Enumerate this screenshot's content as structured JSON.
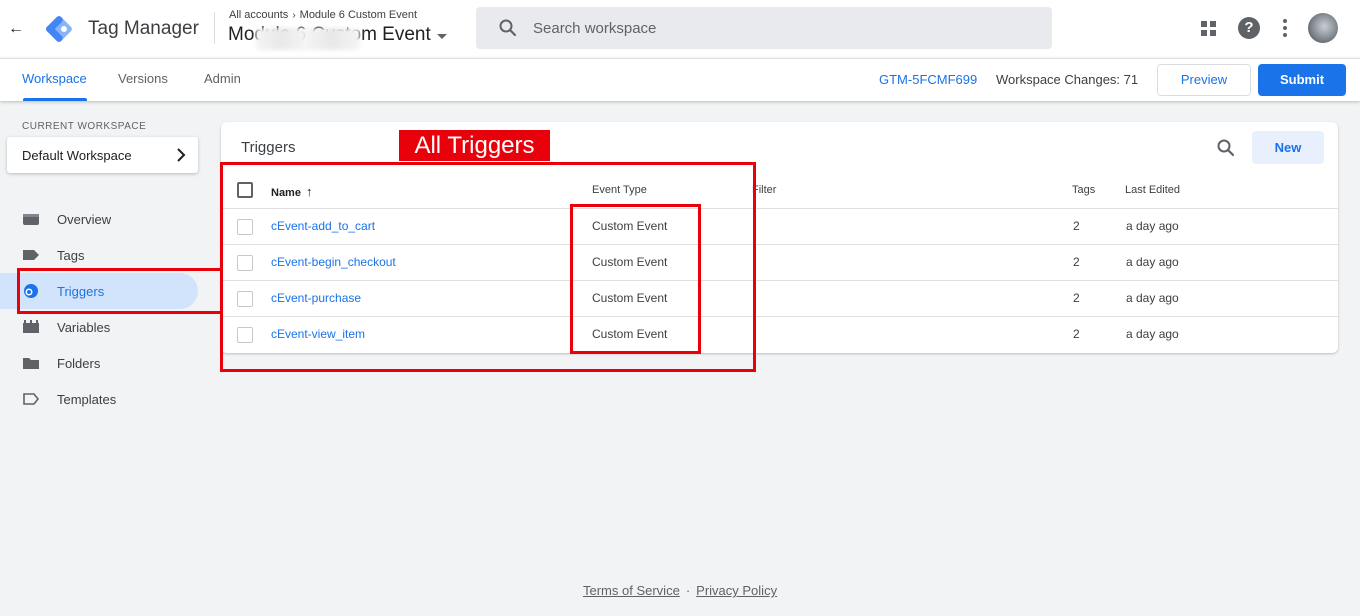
{
  "header": {
    "app_title": "Tag Manager",
    "breadcrumb": {
      "account": "All accounts",
      "container": "Module 6 Custom Event"
    },
    "container_name": "Module 6 Custom Event",
    "search_placeholder": "Search workspace",
    "help_glyph": "?"
  },
  "nav": {
    "tabs": [
      {
        "label": "Workspace",
        "active": true
      },
      {
        "label": "Versions",
        "active": false
      },
      {
        "label": "Admin",
        "active": false
      }
    ],
    "container_id": "GTM-5FCMF699",
    "workspace_changes": "Workspace Changes: 71",
    "preview_label": "Preview",
    "submit_label": "Submit"
  },
  "sidebar": {
    "current_workspace_label": "CURRENT WORKSPACE",
    "workspace_name": "Default Workspace",
    "items": [
      {
        "label": "Overview",
        "icon": "overview-icon",
        "active": false
      },
      {
        "label": "Tags",
        "icon": "tag-icon",
        "active": false
      },
      {
        "label": "Triggers",
        "icon": "trigger-icon",
        "active": true
      },
      {
        "label": "Variables",
        "icon": "variables-icon",
        "active": false
      },
      {
        "label": "Folders",
        "icon": "folder-icon",
        "active": false
      },
      {
        "label": "Templates",
        "icon": "template-icon",
        "active": false
      }
    ]
  },
  "triggers": {
    "title": "Triggers",
    "new_label": "New",
    "columns": {
      "name": "Name",
      "event_type": "Event Type",
      "filter": "Filter",
      "tags": "Tags",
      "last_edited": "Last Edited"
    },
    "rows": [
      {
        "name": "cEvent-add_to_cart",
        "event_type": "Custom Event",
        "filter": "",
        "tags": "2",
        "last_edited": "a day ago"
      },
      {
        "name": "cEvent-begin_checkout",
        "event_type": "Custom Event",
        "filter": "",
        "tags": "2",
        "last_edited": "a day ago"
      },
      {
        "name": "cEvent-purchase",
        "event_type": "Custom Event",
        "filter": "",
        "tags": "2",
        "last_edited": "a day ago"
      },
      {
        "name": "cEvent-view_item",
        "event_type": "Custom Event",
        "filter": "",
        "tags": "2",
        "last_edited": "a day ago"
      }
    ]
  },
  "annotation": {
    "label": "All Triggers",
    "color": "#e8000b"
  },
  "footer": {
    "terms": "Terms of Service",
    "separator": "·",
    "privacy": "Privacy Policy"
  },
  "colors": {
    "accent": "#1a73e8",
    "active_nav_bg": "#d2e3fc"
  }
}
